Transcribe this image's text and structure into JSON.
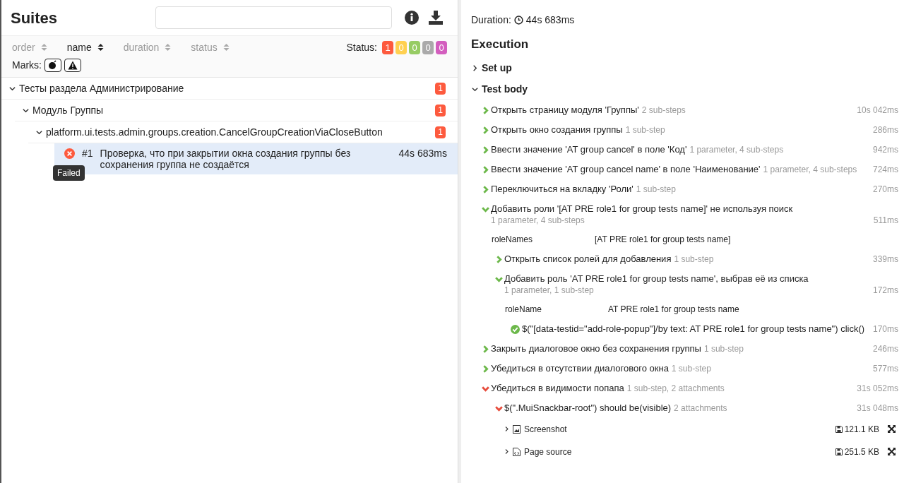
{
  "suites": {
    "title": "Suites",
    "sorters": [
      {
        "label": "order",
        "selected": false
      },
      {
        "label": "name",
        "selected": true
      },
      {
        "label": "duration",
        "selected": false
      },
      {
        "label": "status",
        "selected": false
      }
    ],
    "status_label": "Status:",
    "status_counts": [
      {
        "count": "1",
        "color": "#fd5a3e"
      },
      {
        "count": "0",
        "color": "#ffd050"
      },
      {
        "count": "0",
        "color": "#97cc64"
      },
      {
        "count": "0",
        "color": "#aaaaaa"
      },
      {
        "count": "0",
        "color": "#d35ebe"
      }
    ],
    "marks_label": "Marks:",
    "marks": [
      {
        "kind": "flaky",
        "on": false
      },
      {
        "kind": "warning",
        "on": false
      }
    ],
    "tree": [
      {
        "name": "Тесты раздела Администрирование",
        "count": "1",
        "expanded": true,
        "children": [
          {
            "name": "Модуль Группы",
            "count": "1",
            "expanded": true,
            "children": [
              {
                "name": "platform.ui.tests.admin.groups.creation.CancelGroupCreationViaCloseButton",
                "count": "1",
                "expanded": true,
                "tests": [
                  {
                    "number": "#1",
                    "name": "Проверка, что при закрытии окна создания группы без сохранения группа не создаётся",
                    "duration": "44s 683ms",
                    "failed": true,
                    "selected": true,
                    "tooltip": "Failed"
                  }
                ]
              }
            ]
          }
        ]
      }
    ]
  },
  "details": {
    "duration_label": "Duration:",
    "duration": "44s 683ms",
    "execution_title": "Execution",
    "sections": [
      {
        "title": "Set up",
        "expanded": false
      },
      {
        "title": "Test body",
        "expanded": true,
        "steps": [
          {
            "kind": "group",
            "failed": false,
            "expanded": false,
            "name": "Открыть страницу модуля 'Группы'",
            "meta": "2 sub-steps",
            "time": "10s 042ms"
          },
          {
            "kind": "group",
            "failed": false,
            "expanded": false,
            "name": "Открыть окно создания группы",
            "meta": "1 sub-step",
            "time": "286ms"
          },
          {
            "kind": "group",
            "failed": false,
            "expanded": false,
            "name": "Ввести значение 'AT group cancel' в поле 'Код'",
            "meta": "1 parameter, 4 sub-steps",
            "time": "942ms"
          },
          {
            "kind": "group",
            "failed": false,
            "expanded": false,
            "name": "Ввести значение 'AT group cancel name' в поле 'Наименование'",
            "meta": "1 parameter, 4 sub-steps",
            "time": "724ms"
          },
          {
            "kind": "group",
            "failed": false,
            "expanded": false,
            "name": "Переключиться на вкладку 'Роли'",
            "meta": "1 sub-step",
            "time": "270ms"
          },
          {
            "kind": "group",
            "failed": false,
            "expanded": true,
            "name": "Добавить роли '[AT PRE role1 for group tests name]' не используя поиск",
            "meta": "1 parameter, 4 sub-steps",
            "time": "511ms",
            "parameters": [
              {
                "name": "roleNames",
                "value": "[AT PRE role1 for group tests name]"
              }
            ],
            "children": [
              {
                "kind": "group",
                "failed": false,
                "expanded": false,
                "name": "Открыть список ролей для добавления",
                "meta": "1 sub-step",
                "time": "339ms"
              },
              {
                "kind": "group",
                "failed": false,
                "expanded": true,
                "name": "Добавить роль 'AT PRE role1 for group tests name', выбрав её из списка",
                "meta": "1 parameter, 1 sub-step",
                "time": "172ms",
                "parameters": [
                  {
                    "name": "roleName",
                    "value": "AT PRE role1 for group tests name"
                  }
                ],
                "children": [
                  {
                    "kind": "leaf",
                    "failed": false,
                    "name": "$(\"[data-testid=\"add-role-popup\"]/by text: AT PRE role1 for group tests name\") click()",
                    "time": "170ms"
                  }
                ]
              }
            ]
          },
          {
            "kind": "group",
            "failed": false,
            "expanded": false,
            "name": "Закрыть диалоговое окно без сохранения группы",
            "meta": "1 sub-step",
            "time": "246ms"
          },
          {
            "kind": "group",
            "failed": false,
            "expanded": false,
            "name": "Убедиться в отсутствии диалогового окна",
            "meta": "1 sub-step",
            "time": "577ms"
          },
          {
            "kind": "group",
            "failed": true,
            "expanded": true,
            "name": "Убедиться в видимости попапа",
            "meta": "1 sub-step, 2 attachments",
            "time": "31s 052ms",
            "children": [
              {
                "kind": "group",
                "failed": true,
                "expanded": true,
                "name": "$(\".MuiSnackbar-root\") should be(visible)",
                "meta": "2 attachments",
                "time": "31s 048ms",
                "children": [
                  {
                    "kind": "image",
                    "name": "Screenshot",
                    "size": "121.1 KB"
                  },
                  {
                    "kind": "source",
                    "name": "Page source",
                    "size": "251.5 KB"
                  }
                ]
              }
            ]
          }
        ]
      }
    ]
  }
}
